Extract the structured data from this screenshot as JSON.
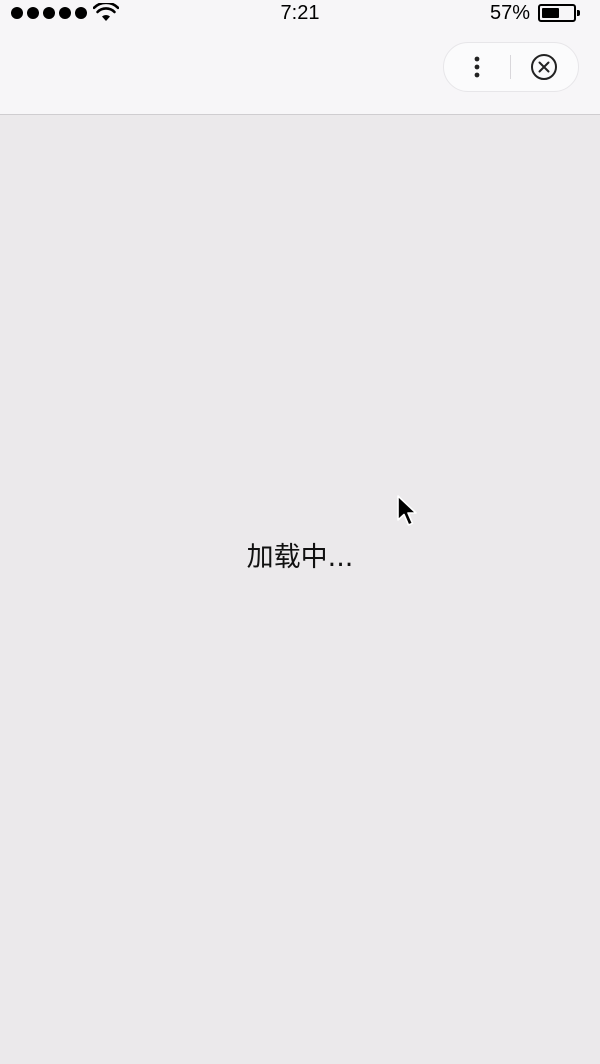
{
  "status_bar": {
    "signal_dots": 5,
    "wifi_icon": "wifi-icon",
    "time": "7:21",
    "battery_percent_label": "57%",
    "battery_level": 0.57,
    "battery_icon": "battery-icon"
  },
  "nav": {
    "more_icon": "more-vertical-icon",
    "close_icon": "close-circle-icon"
  },
  "main": {
    "loading_text": "加载中..."
  },
  "colors": {
    "background": "#ebe9eb",
    "bar_background": "#f7f6f8",
    "text": "#000000"
  }
}
